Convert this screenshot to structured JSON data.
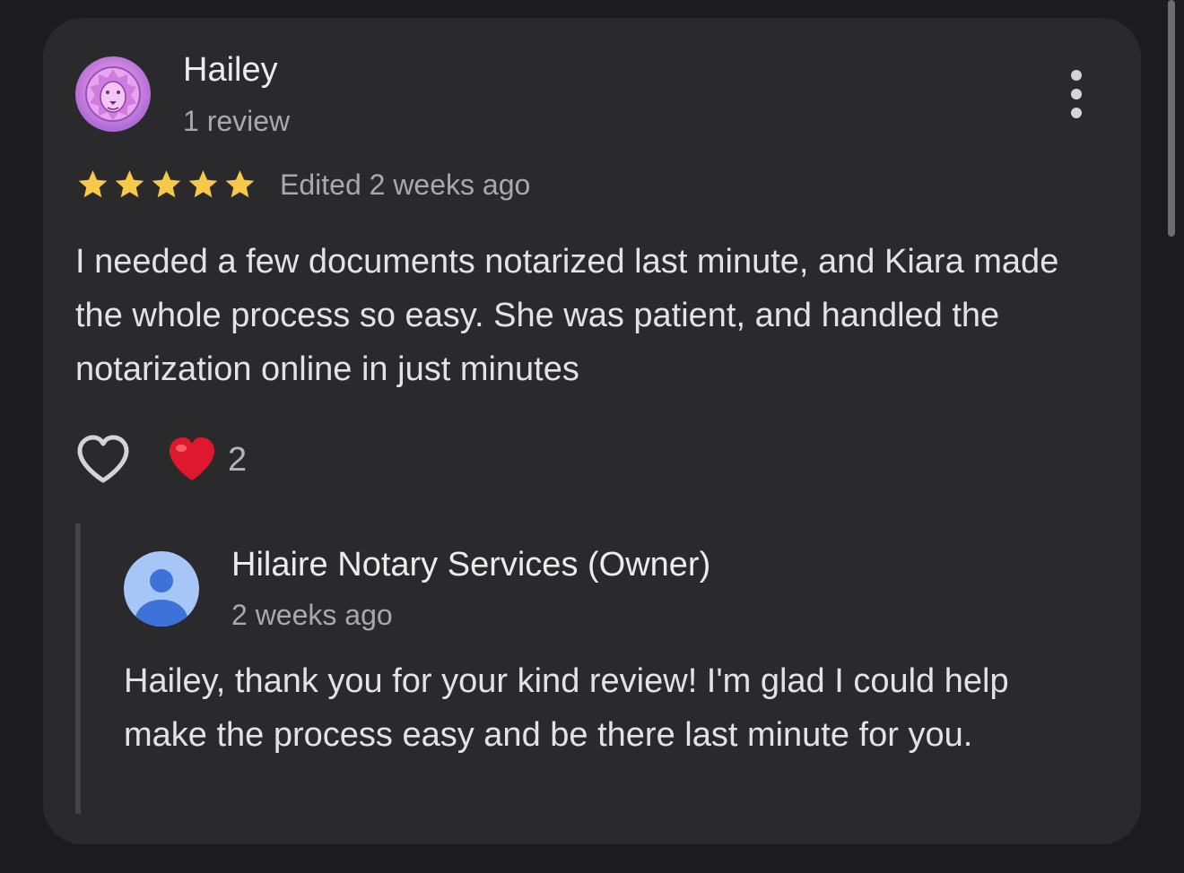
{
  "review": {
    "reviewer_name": "Hailey",
    "reviewer_meta": "1 review",
    "rating": 5,
    "rating_max": 5,
    "edited_label": "Edited 2 weeks ago",
    "text": "I needed a few documents notarized last minute, and Kiara made the whole process so easy. She was patient, and handled the notarization online in just minutes",
    "reaction_emoji": "heart",
    "reaction_count": "2",
    "star_color": "#f7c948"
  },
  "owner_reply": {
    "name": "Hilaire Notary Services (Owner)",
    "time": "2 weeks ago",
    "text": "Hailey, thank you for your kind review! I'm glad I could help make the process easy and be there last minute for you."
  },
  "icons": {
    "reviewer_avatar": "lion-avatar-icon",
    "more_options": "more-vert-icon",
    "like": "heart-outline-icon",
    "reaction": "red-heart-icon",
    "owner_avatar": "person-icon"
  }
}
